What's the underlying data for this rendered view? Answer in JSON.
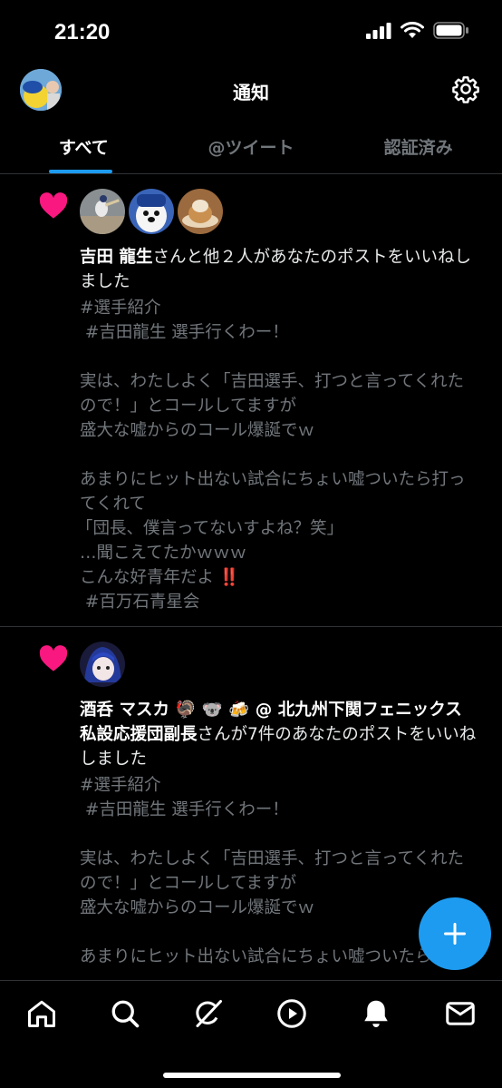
{
  "status": {
    "time": "21:20"
  },
  "header": {
    "title": "通知"
  },
  "tabs": [
    {
      "label": "すべて",
      "active": true
    },
    {
      "label": "@ツイート",
      "active": false
    },
    {
      "label": "認証済み",
      "active": false
    }
  ],
  "notifications": [
    {
      "name": "吉田 龍生",
      "action": "さんと他２人があなたのポストをいいねしました",
      "post_lines": [
        "#選手紹介",
        " #吉田龍生 選手行くわー！",
        "",
        "実は、わたしよく「吉田選手、打つと言ってくれたので！」とコールしてますが",
        "盛大な嘘からのコール爆誕でｗ",
        "",
        "あまりにヒット出ない試合にちょい嘘ついたら打ってくれて",
        "「団長、僕言ってないすよね？笑」",
        "…聞こえてたかｗｗｗ",
        "こんな好青年だよ ‼️",
        " #百万石青星会"
      ]
    },
    {
      "name": "酒呑 マスカ 🦃 🐨 🍻 @ 北九州下関フェニックス私設応援団副長",
      "action": "さんが7件のあなたのポストをいいねしました",
      "post_lines": [
        "#選手紹介",
        " #吉田龍生 選手行くわー！",
        "",
        "実は、わたしよく「吉田選手、打つと言ってくれたので！」とコールしてますが",
        "盛大な嘘からのコール爆誕でｗ",
        "",
        "あまりにヒット出ない試合にちょい嘘ついたら打"
      ]
    }
  ],
  "colors": {
    "accent": "#1d9bf0",
    "like": "#f91880",
    "background": "#000000"
  },
  "icons": {
    "nav": [
      "home-icon",
      "search-icon",
      "grok-icon",
      "play-icon",
      "bell-icon",
      "mail-icon"
    ],
    "fab": "plus-icon"
  }
}
